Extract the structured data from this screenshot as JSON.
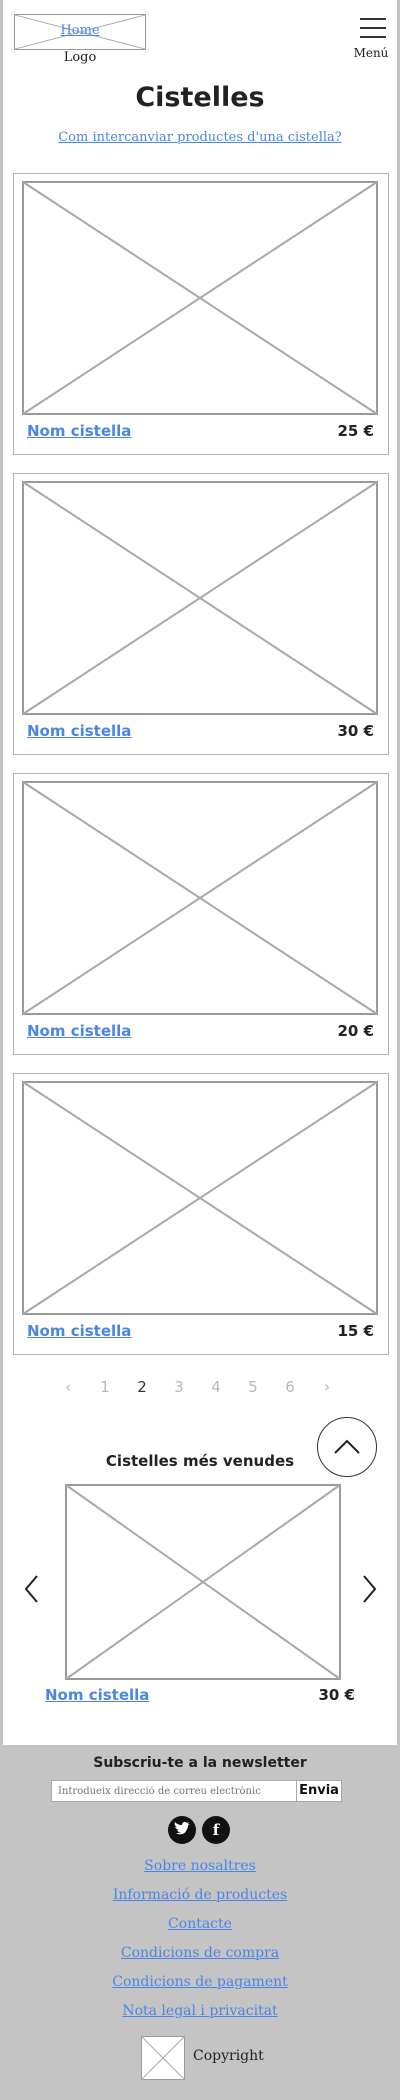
{
  "header": {
    "logo_link": "Home",
    "logo_caption": "Logo",
    "menu_label": "Menú"
  },
  "main": {
    "title": "Cistelles",
    "swap_link": "Com intercanviar productes d'una cistella?",
    "cards": [
      {
        "name": "Nom cistella",
        "price": "25 €"
      },
      {
        "name": "Nom cistella",
        "price": "30 €"
      },
      {
        "name": "Nom cistella",
        "price": "20 €"
      },
      {
        "name": "Nom cistella",
        "price": "15 €"
      }
    ],
    "pagination": {
      "prev": "‹",
      "pages": [
        "1",
        "2",
        "3",
        "4",
        "5",
        "6"
      ],
      "current": "2",
      "next": "›"
    }
  },
  "best_sellers": {
    "title": "Cistelles més venudes",
    "item": {
      "name": "Nom cistella",
      "price": "30 €"
    }
  },
  "footer": {
    "newsletter_title": "Subscriu-te a la newsletter",
    "newsletter_placeholder": "Introdueix direcció de correu electrònic",
    "newsletter_button": "Envia",
    "social": [
      {
        "icon": "twitter-icon"
      },
      {
        "icon": "facebook-icon"
      }
    ],
    "facebook_glyph": "f",
    "links": [
      "Sobre nosaltres",
      "Informació de productes",
      "Contacte",
      "Condicions de compra",
      "Condicions de pagament",
      "Nota legal i privacitat"
    ],
    "copyright": "Copyright"
  },
  "colors": {
    "link": "#4a86e8",
    "footer_bg": "#c4c4c4",
    "page_bg": "#ffffff"
  }
}
